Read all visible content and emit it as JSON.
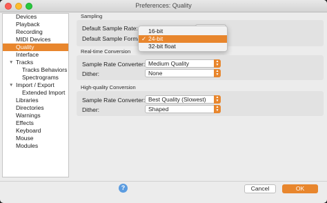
{
  "window": {
    "title": "Preferences: Quality"
  },
  "sidebar": {
    "items": [
      {
        "label": "Devices"
      },
      {
        "label": "Playback"
      },
      {
        "label": "Recording"
      },
      {
        "label": "MIDI Devices"
      },
      {
        "label": "Quality",
        "selected": true
      },
      {
        "label": "Interface"
      },
      {
        "label": "Tracks",
        "expander": "▼"
      },
      {
        "label": "Tracks Behaviors"
      },
      {
        "label": "Spectrograms"
      },
      {
        "label": "Import / Export",
        "expander": "▼"
      },
      {
        "label": "Extended Import"
      },
      {
        "label": "Libraries"
      },
      {
        "label": "Directories"
      },
      {
        "label": "Warnings"
      },
      {
        "label": "Effects"
      },
      {
        "label": "Keyboard"
      },
      {
        "label": "Mouse"
      },
      {
        "label": "Modules"
      }
    ]
  },
  "sampling": {
    "title": "Sampling",
    "default_rate_label": "Default Sample Rate:",
    "default_format_label": "Default Sample Format:"
  },
  "format_menu": {
    "items": [
      {
        "label": "16-bit"
      },
      {
        "label": "24-bit",
        "checked": "✓",
        "highlighted": true
      },
      {
        "label": "32-bit float"
      }
    ]
  },
  "realtime": {
    "title": "Real-time Conversion",
    "converter_label": "Sample Rate Converter:",
    "converter_value": "Medium Quality",
    "dither_label": "Dither:",
    "dither_value": "None"
  },
  "highquality": {
    "title": "High-quality Conversion",
    "converter_label": "Sample Rate Converter:",
    "converter_value": "Best Quality (Slowest)",
    "dither_label": "Dither:",
    "dither_value": "Shaped"
  },
  "footer": {
    "help": "?",
    "cancel": "Cancel",
    "ok": "OK"
  },
  "colors": {
    "accent": "#e8862d",
    "help": "#5b9ce0"
  }
}
